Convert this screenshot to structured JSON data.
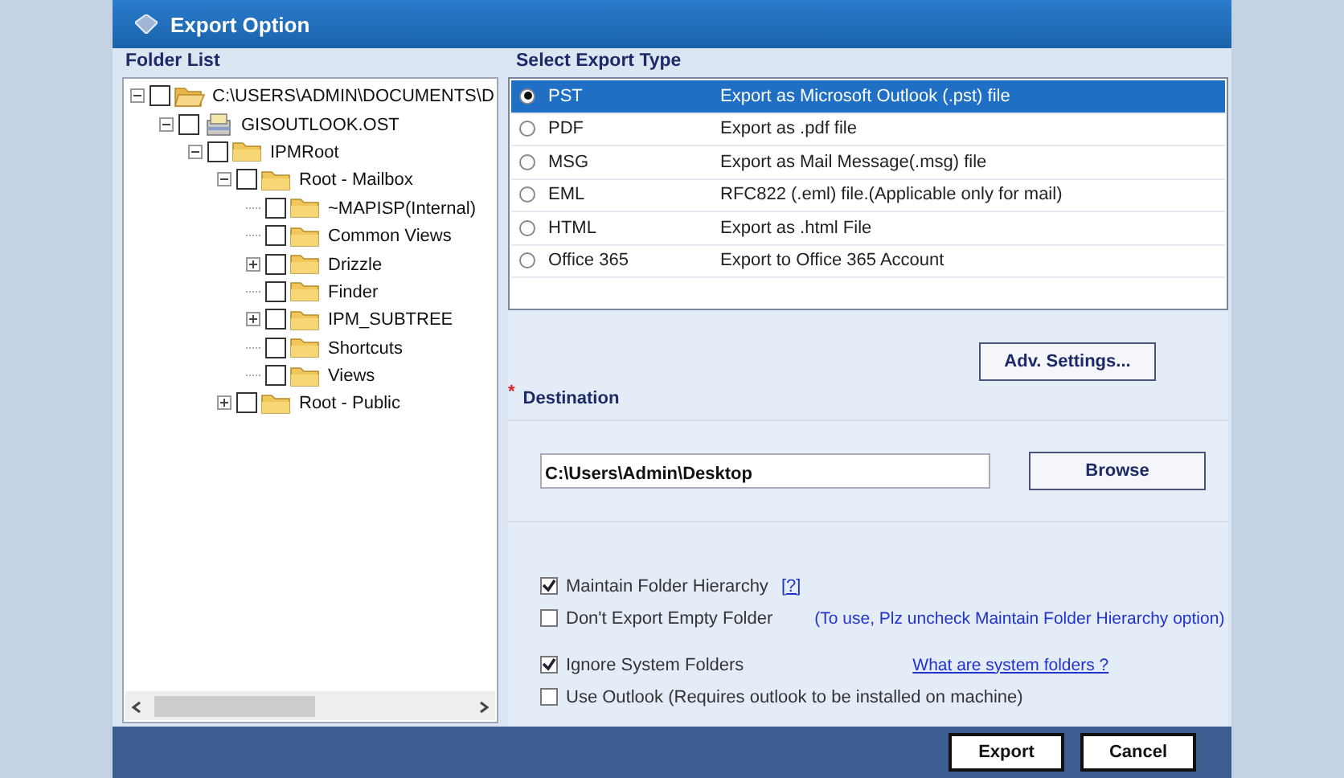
{
  "window": {
    "title": "Export Option"
  },
  "folder_list": {
    "label": "Folder List",
    "tree": [
      {
        "label": "C:\\USERS\\ADMIN\\DOCUMENTS\\D",
        "kind": "folder-open",
        "checked": false,
        "expanded": true,
        "children": [
          {
            "label": "GISOUTLOOK.OST",
            "kind": "data-file",
            "checked": false,
            "expanded": true,
            "children": [
              {
                "label": "IPMRoot",
                "kind": "folder",
                "checked": false,
                "expanded": true,
                "children": [
                  {
                    "label": "Root - Mailbox",
                    "kind": "folder",
                    "checked": false,
                    "expanded": true,
                    "children": [
                      {
                        "label": "~MAPISP(Internal)",
                        "kind": "folder",
                        "checked": false
                      },
                      {
                        "label": "Common Views",
                        "kind": "folder",
                        "checked": false
                      },
                      {
                        "label": "Drizzle",
                        "kind": "folder",
                        "checked": false,
                        "expanded": false
                      },
                      {
                        "label": "Finder",
                        "kind": "folder",
                        "checked": false
                      },
                      {
                        "label": "IPM_SUBTREE",
                        "kind": "folder",
                        "checked": false,
                        "expanded": false
                      },
                      {
                        "label": "Shortcuts",
                        "kind": "folder",
                        "checked": false
                      },
                      {
                        "label": "Views",
                        "kind": "folder",
                        "checked": false
                      }
                    ]
                  },
                  {
                    "label": "Root - Public",
                    "kind": "folder",
                    "checked": false,
                    "expanded": false
                  }
                ]
              }
            ]
          }
        ]
      }
    ]
  },
  "export_type": {
    "label": "Select Export Type",
    "options": [
      {
        "name": "PST",
        "description": "Export as Microsoft Outlook (.pst) file",
        "selected": true
      },
      {
        "name": "PDF",
        "description": "Export as .pdf file",
        "selected": false
      },
      {
        "name": "MSG",
        "description": "Export as Mail Message(.msg) file",
        "selected": false
      },
      {
        "name": "EML",
        "description": "RFC822 (.eml) file.(Applicable only for mail)",
        "selected": false
      },
      {
        "name": "HTML",
        "description": "Export as .html File",
        "selected": false
      },
      {
        "name": "Office 365",
        "description": "Export to Office 365 Account",
        "selected": false
      }
    ]
  },
  "adv_settings_button": "Adv. Settings...",
  "destination": {
    "required_mark": "*",
    "label": "Destination",
    "value": "C:\\Users\\Admin\\Desktop",
    "browse_button": "Browse"
  },
  "options": [
    {
      "label": "Maintain Folder Hierarchy",
      "checked": true,
      "extra": {
        "kind": "help",
        "text": "[?]"
      }
    },
    {
      "label": "Don't Export Empty Folder",
      "checked": false,
      "extra": {
        "kind": "note",
        "text": "(To use, Plz uncheck Maintain Folder Hierarchy option)"
      }
    },
    {
      "label": "Ignore System Folders",
      "checked": true,
      "extra": {
        "kind": "link",
        "text": "What are system folders ?"
      }
    },
    {
      "label": "Use Outlook (Requires outlook to be installed on machine)",
      "checked": false
    }
  ],
  "buttons": [
    {
      "label": "Export"
    },
    {
      "label": "Cancel"
    }
  ]
}
